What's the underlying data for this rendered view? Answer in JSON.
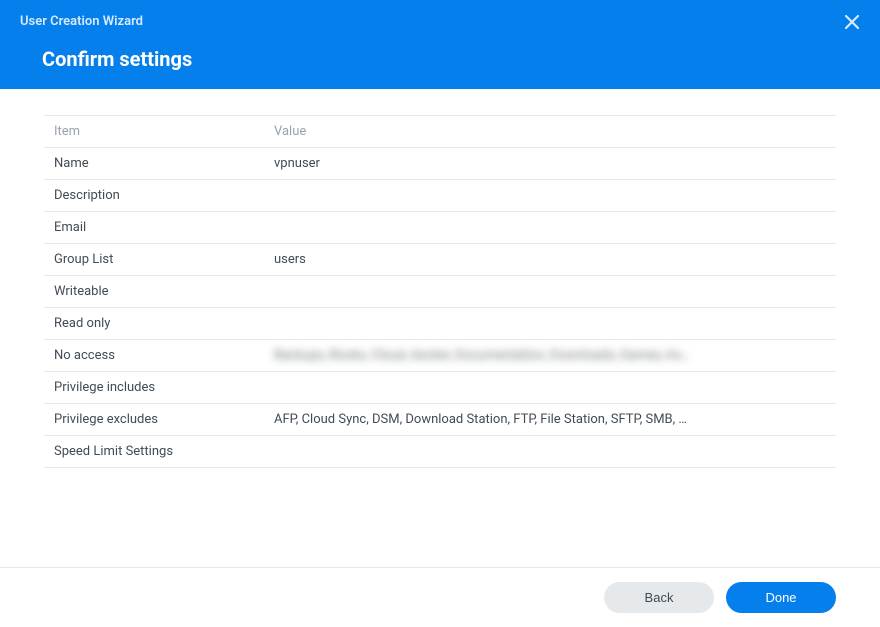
{
  "header": {
    "title": "User Creation Wizard",
    "subtitle": "Confirm settings"
  },
  "table": {
    "columns": {
      "item": "Item",
      "value": "Value"
    },
    "rows": [
      {
        "key": "Name",
        "value": "vpnuser",
        "blurred": false
      },
      {
        "key": "Description",
        "value": "",
        "blurred": false
      },
      {
        "key": "Email",
        "value": "",
        "blurred": false
      },
      {
        "key": "Group List",
        "value": "users",
        "blurred": false
      },
      {
        "key": "Writeable",
        "value": "",
        "blurred": false
      },
      {
        "key": "Read only",
        "value": "",
        "blurred": false
      },
      {
        "key": "No access",
        "value": "Backups, Books, Cloud, docker, Documentation, Downloads, Games, ho…",
        "blurred": true
      },
      {
        "key": "Privilege includes",
        "value": "",
        "blurred": false
      },
      {
        "key": "Privilege excludes",
        "value": "AFP, Cloud Sync, DSM, Download Station, FTP, File Station, SFTP, SMB, …",
        "blurred": false
      },
      {
        "key": "Speed Limit Settings",
        "value": "",
        "blurred": false
      }
    ]
  },
  "footer": {
    "back": "Back",
    "done": "Done"
  }
}
